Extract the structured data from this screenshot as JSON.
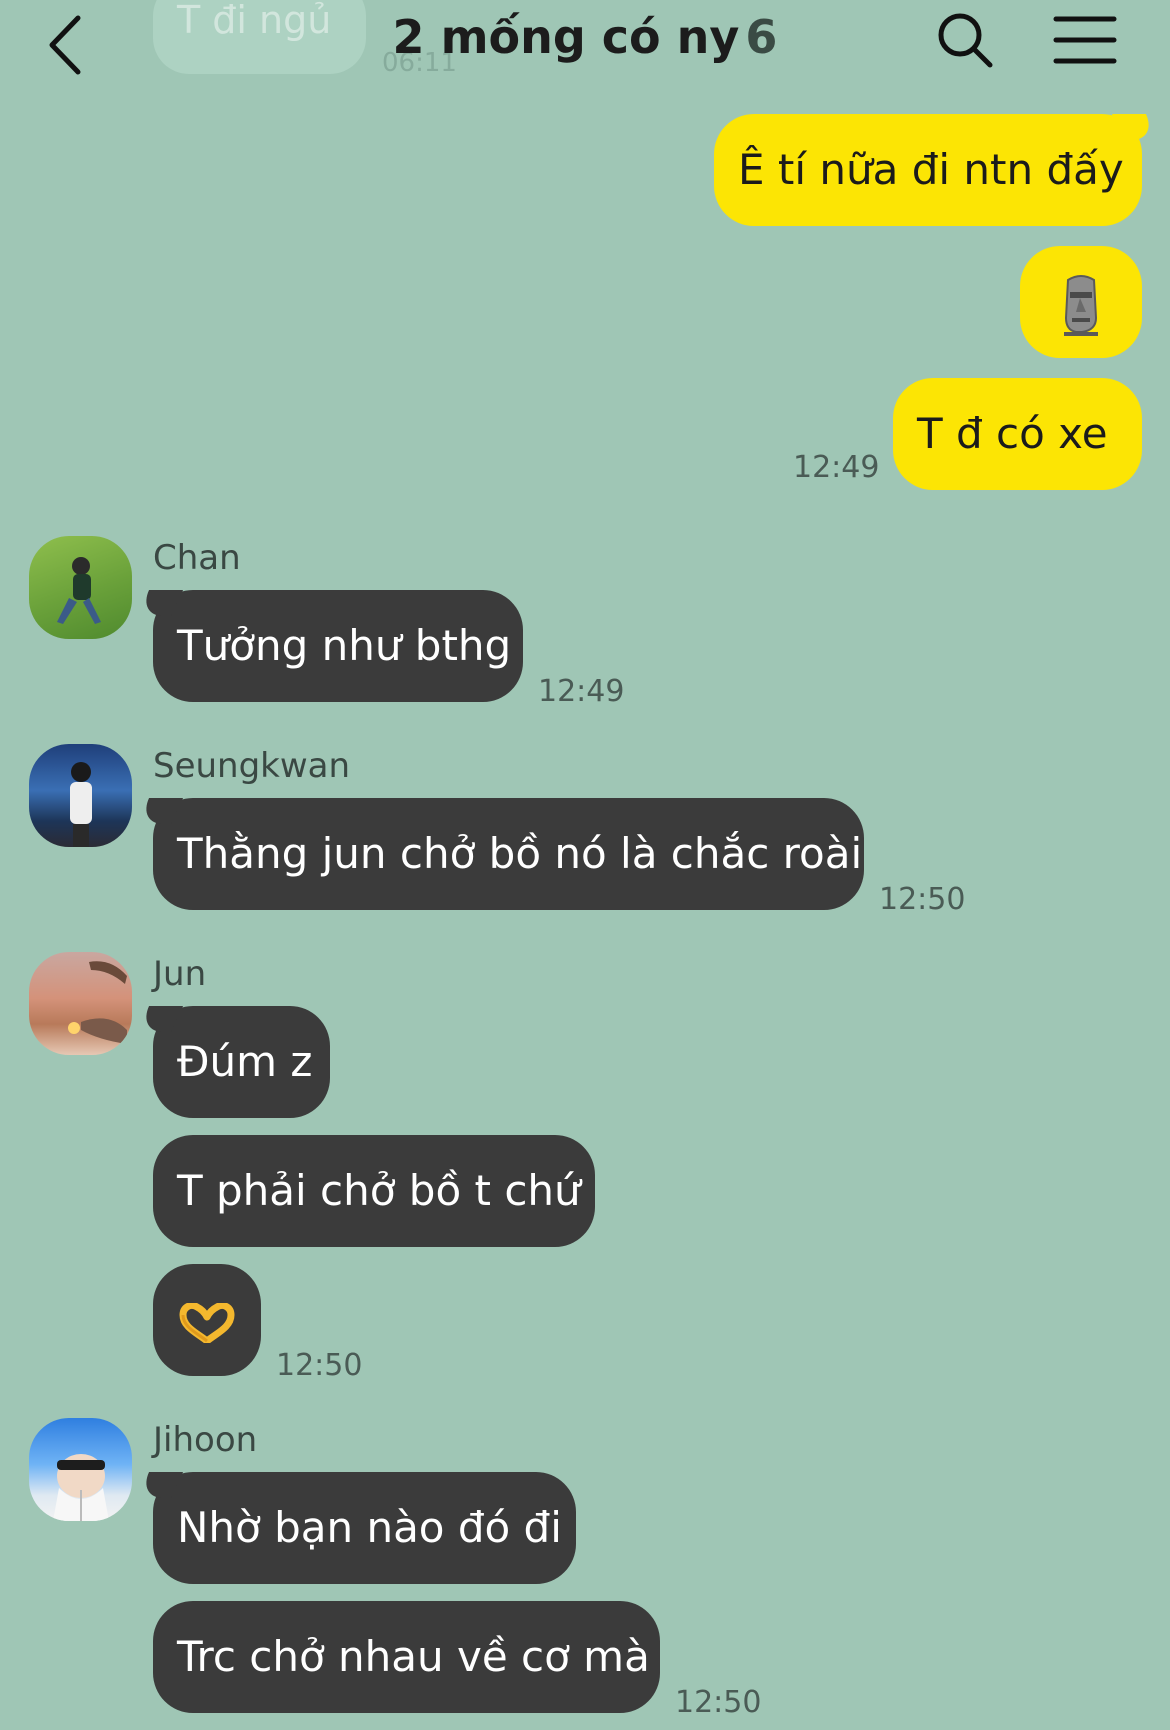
{
  "header": {
    "title": "2 mống có ny",
    "member_count": "6",
    "ghost_message": "T đi ngủ",
    "ghost_time": "06:11"
  },
  "messages": [
    {
      "sender": "me",
      "text": "Ê tí nữa đi ntn đấy"
    },
    {
      "sender": "me",
      "emoji": "moai-emoji"
    },
    {
      "sender": "me",
      "text": "T đ có xe",
      "time": "12:49"
    },
    {
      "sender": "Chan",
      "text": "Tưởng như bthg",
      "time": "12:49"
    },
    {
      "sender": "Seungkwan",
      "text": "Thằng jun chở bồ nó là chắc roài",
      "time": "12:50"
    },
    {
      "sender": "Jun",
      "text": "Đúm z"
    },
    {
      "sender": "Jun",
      "text": "T phải chở bồ t chứ"
    },
    {
      "sender": "Jun",
      "emoji": "heart-hands-emoji",
      "time": "12:50"
    },
    {
      "sender": "Jihoon",
      "text": "Nhờ bạn nào đó đi"
    },
    {
      "sender": "Jihoon",
      "text": "Trc chở nhau về cơ mà",
      "time": "12:50"
    }
  ],
  "colors": {
    "background": "#9fc6b5",
    "my_bubble": "#fce504",
    "their_bubble": "#3b3b3b"
  }
}
